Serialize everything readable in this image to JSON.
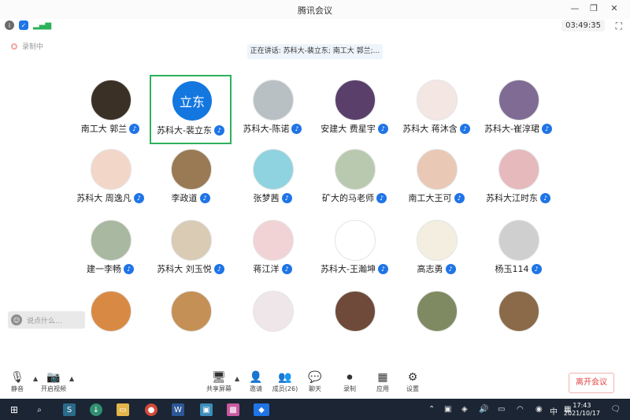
{
  "window": {
    "title": "腾讯会议",
    "minimize": "—",
    "restore": "❐",
    "close": "✕"
  },
  "status": {
    "recording_text": "录制中",
    "timer": "03:49:35",
    "fullscreen": "⛶"
  },
  "speaking": {
    "text": "正在讲话: 苏科大-裴立东; 南工大 郭兰;..."
  },
  "participants": [
    {
      "name": "南工大 郭兰",
      "avatar_text": "",
      "active": false,
      "color": "#3b3026"
    },
    {
      "name": "苏科大-裴立东",
      "avatar_text": "立东",
      "active": true,
      "color": "#1477e0"
    },
    {
      "name": "苏科大-陈诺",
      "avatar_text": "",
      "active": false,
      "color": "#b8c0c4"
    },
    {
      "name": "安建大 费星宇",
      "avatar_text": "",
      "active": false,
      "color": "#5a3f6b"
    },
    {
      "name": "苏科大 蒋沐含",
      "avatar_text": "",
      "active": false,
      "color": "#f3e6e3"
    },
    {
      "name": "苏科大-崔淳珺",
      "avatar_text": "",
      "active": false,
      "color": "#7f6b93"
    },
    {
      "name": "苏科大 周逸凡",
      "avatar_text": "",
      "active": false,
      "color": "#f2d6c8"
    },
    {
      "name": "李政道",
      "avatar_text": "",
      "active": false,
      "color": "#9a7a54"
    },
    {
      "name": "张梦茜",
      "avatar_text": "",
      "active": false,
      "color": "#8fd3e0"
    },
    {
      "name": "矿大的马老师",
      "avatar_text": "",
      "active": false,
      "color": "#b9c9b0"
    },
    {
      "name": "南工大王可",
      "avatar_text": "",
      "active": false,
      "color": "#e9c8b6"
    },
    {
      "name": "苏科大江时东",
      "avatar_text": "",
      "active": false,
      "color": "#e6b9bd"
    },
    {
      "name": "建一李畅",
      "avatar_text": "",
      "active": false,
      "color": "#a9b8a0"
    },
    {
      "name": "苏科大 刘玉悦",
      "avatar_text": "",
      "active": false,
      "color": "#d9cbb4"
    },
    {
      "name": "蒋江洋",
      "avatar_text": "",
      "active": false,
      "color": "#f1d3d6"
    },
    {
      "name": "苏科大-王瀚坤",
      "avatar_text": "",
      "active": false,
      "color": "#ffffff"
    },
    {
      "name": "高志勇",
      "avatar_text": "",
      "active": false,
      "color": "#f3eee0"
    },
    {
      "name": "杨玉114",
      "avatar_text": "",
      "active": false,
      "color": "#cfcfcf"
    },
    {
      "name": "",
      "avatar_text": "",
      "active": false,
      "color": "#d88a44"
    },
    {
      "name": "",
      "avatar_text": "",
      "active": false,
      "color": "#c49055"
    },
    {
      "name": "",
      "avatar_text": "",
      "active": false,
      "color": "#efe6ea"
    },
    {
      "name": "",
      "avatar_text": "",
      "active": false,
      "color": "#6f4a3a"
    },
    {
      "name": "",
      "avatar_text": "",
      "active": false,
      "color": "#7f8a62"
    },
    {
      "name": "",
      "avatar_text": "",
      "active": false,
      "color": "#8a6a48"
    }
  ],
  "reaction": {
    "placeholder": "说点什么..."
  },
  "toolbar": {
    "mute": "静音",
    "video": "开启视频",
    "share": "共享屏幕",
    "invite": "邀请",
    "members": "成员(26)",
    "chat": "聊天",
    "record": "录制",
    "apps": "应用",
    "settings": "设置",
    "leave": "离开会议"
  },
  "taskbar": {
    "time": "17:43",
    "date": "2021/10/17",
    "ime": "中"
  }
}
